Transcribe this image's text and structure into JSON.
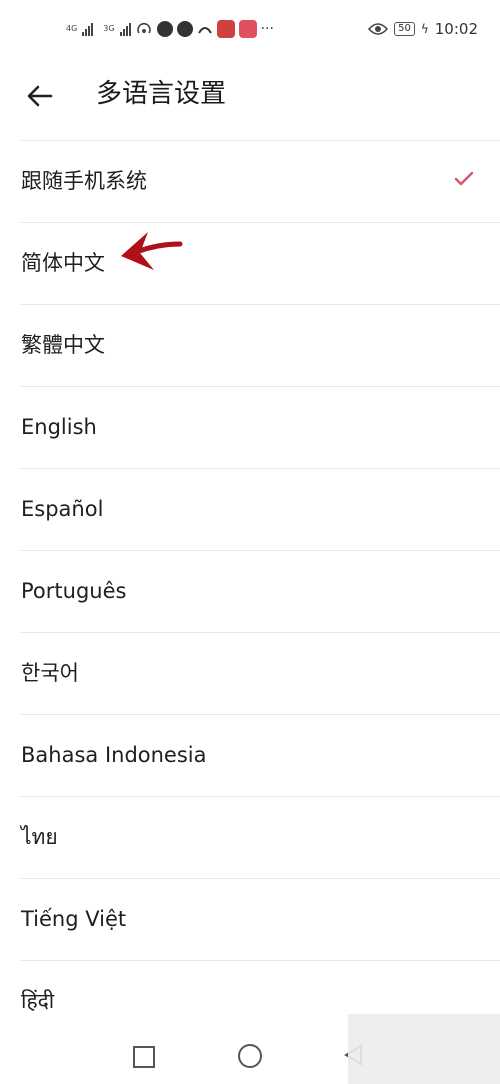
{
  "status_bar": {
    "net1": "4G",
    "net2": "3G",
    "battery": "50",
    "time": "10:02"
  },
  "header": {
    "title": "多语言设置"
  },
  "languages": [
    {
      "label": "跟随手机系统",
      "selected": true
    },
    {
      "label": "简体中文",
      "selected": false
    },
    {
      "label": "繁體中文",
      "selected": false
    },
    {
      "label": "English",
      "selected": false
    },
    {
      "label": "Español",
      "selected": false
    },
    {
      "label": "Português",
      "selected": false
    },
    {
      "label": "한국어",
      "selected": false
    },
    {
      "label": "Bahasa Indonesia",
      "selected": false
    },
    {
      "label": "ไทย",
      "selected": false
    },
    {
      "label": "Tiếng Việt",
      "selected": false
    },
    {
      "label": "हिंदी",
      "selected": false
    }
  ],
  "colors": {
    "check": "#d9566a",
    "annotation_arrow": "#b0101a"
  }
}
